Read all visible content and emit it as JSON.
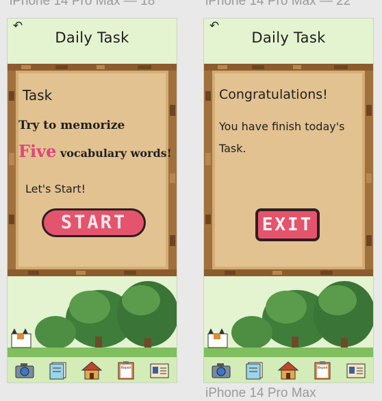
{
  "frames": [
    {
      "label": "iPhone 14 Pro Max — 18",
      "title": "Daily Task",
      "back_icon": "↶",
      "task_title": "Task",
      "line1": "Try  to memorize",
      "emphasis": "Five",
      "line2_rest": " vocabulary words!",
      "lets_start": "Let's Start!",
      "start_label": "START"
    },
    {
      "label": "iPhone 14 Pro Max — 22",
      "title": "Daily Task",
      "back_icon": "↶",
      "congrats": "Congratulations!",
      "msg1": "You have finish today's",
      "msg2": "Task.",
      "exit_label": "EXIT"
    }
  ],
  "bottom_label": "iPhone 14 Pro Max",
  "nav_icons": [
    "camera-icon",
    "notebook-icon",
    "home-icon",
    "report-clipboard-icon",
    "profile-card-icon"
  ],
  "report_icon_text": "Report",
  "colors": {
    "background": "#e4f3d0",
    "parchment": "#e2c291",
    "parchment_border": "#a0713d",
    "button": "#e4546c",
    "emphasis": "#e0457a",
    "nav_bar": "#d3ecb8"
  }
}
